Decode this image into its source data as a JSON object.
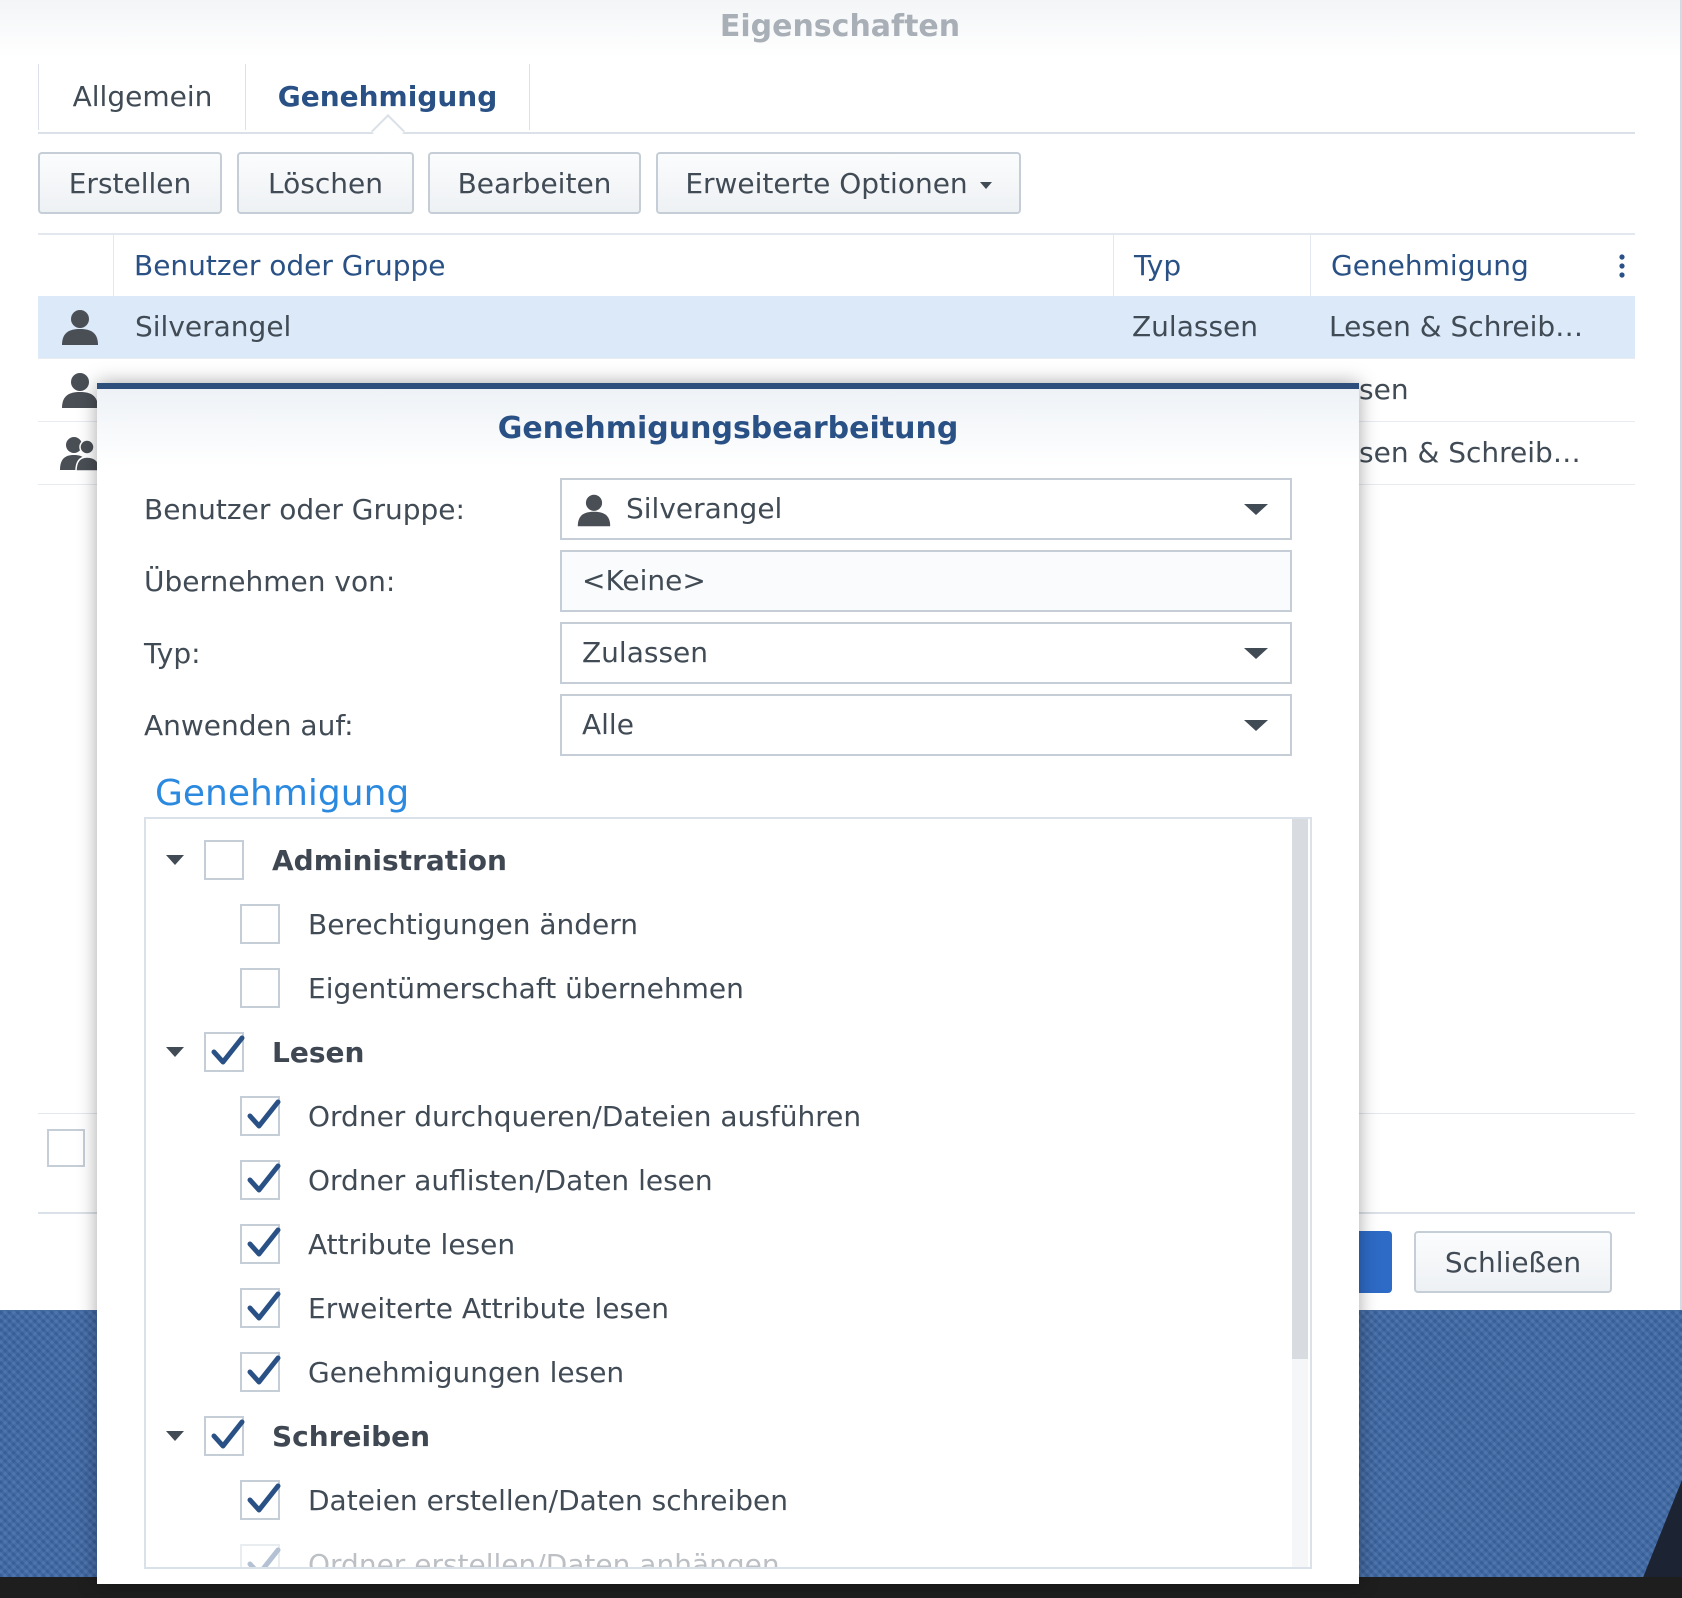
{
  "window": {
    "title": "Eigenschaften",
    "tabs": [
      {
        "label": "Allgemein",
        "active": false
      },
      {
        "label": "Genehmigung",
        "active": true
      }
    ],
    "toolbar": {
      "create": "Erstellen",
      "delete": "Löschen",
      "edit": "Bearbeiten",
      "advanced": "Erweiterte Optionen"
    },
    "grid": {
      "columns": [
        "Benutzer oder Gruppe",
        "Typ",
        "Genehmigung"
      ],
      "rows": [
        {
          "icon": "user-icon",
          "name": "Silverangel",
          "type": "Zulassen",
          "permission": "Lesen & Schreib…",
          "selected": true
        },
        {
          "icon": "user-icon",
          "name": "",
          "type": "",
          "permission": "sen",
          "selected": false
        },
        {
          "icon": "group-icon",
          "name": "",
          "type": "",
          "permission": "sen & Schreib…",
          "selected": false
        }
      ]
    },
    "close_label": "Schließen",
    "colors": {
      "accent": "#2a5185",
      "selected_row": "#dce9f8",
      "apply_button": "#2e6bc6",
      "desktop": "#3e68a6"
    }
  },
  "dialog": {
    "title": "Genehmigungsbearbeitung",
    "fields": {
      "user_label": "Benutzer oder Gruppe:",
      "user_value": "Silverangel",
      "inherit_label": "Übernehmen von:",
      "inherit_value": "<Keine>",
      "type_label": "Typ:",
      "type_value": "Zulassen",
      "apply_label": "Anwenden auf:",
      "apply_value": "Alle"
    },
    "section_title": "Genehmigung",
    "permissions": [
      {
        "label": "Administration",
        "group": true,
        "checked": false
      },
      {
        "label": "Berechtigungen ändern",
        "group": false,
        "checked": false
      },
      {
        "label": "Eigentümerschaft übernehmen",
        "group": false,
        "checked": false
      },
      {
        "label": "Lesen",
        "group": true,
        "checked": true
      },
      {
        "label": "Ordner durchqueren/Dateien ausführen",
        "group": false,
        "checked": true
      },
      {
        "label": "Ordner auflisten/Daten lesen",
        "group": false,
        "checked": true
      },
      {
        "label": "Attribute lesen",
        "group": false,
        "checked": true
      },
      {
        "label": "Erweiterte Attribute lesen",
        "group": false,
        "checked": true
      },
      {
        "label": "Genehmigungen lesen",
        "group": false,
        "checked": true
      },
      {
        "label": "Schreiben",
        "group": true,
        "checked": true
      },
      {
        "label": "Dateien erstellen/Daten schreiben",
        "group": false,
        "checked": true
      },
      {
        "label": "Ordner erstellen/Daten anhängen",
        "group": false,
        "checked": true
      }
    ]
  }
}
